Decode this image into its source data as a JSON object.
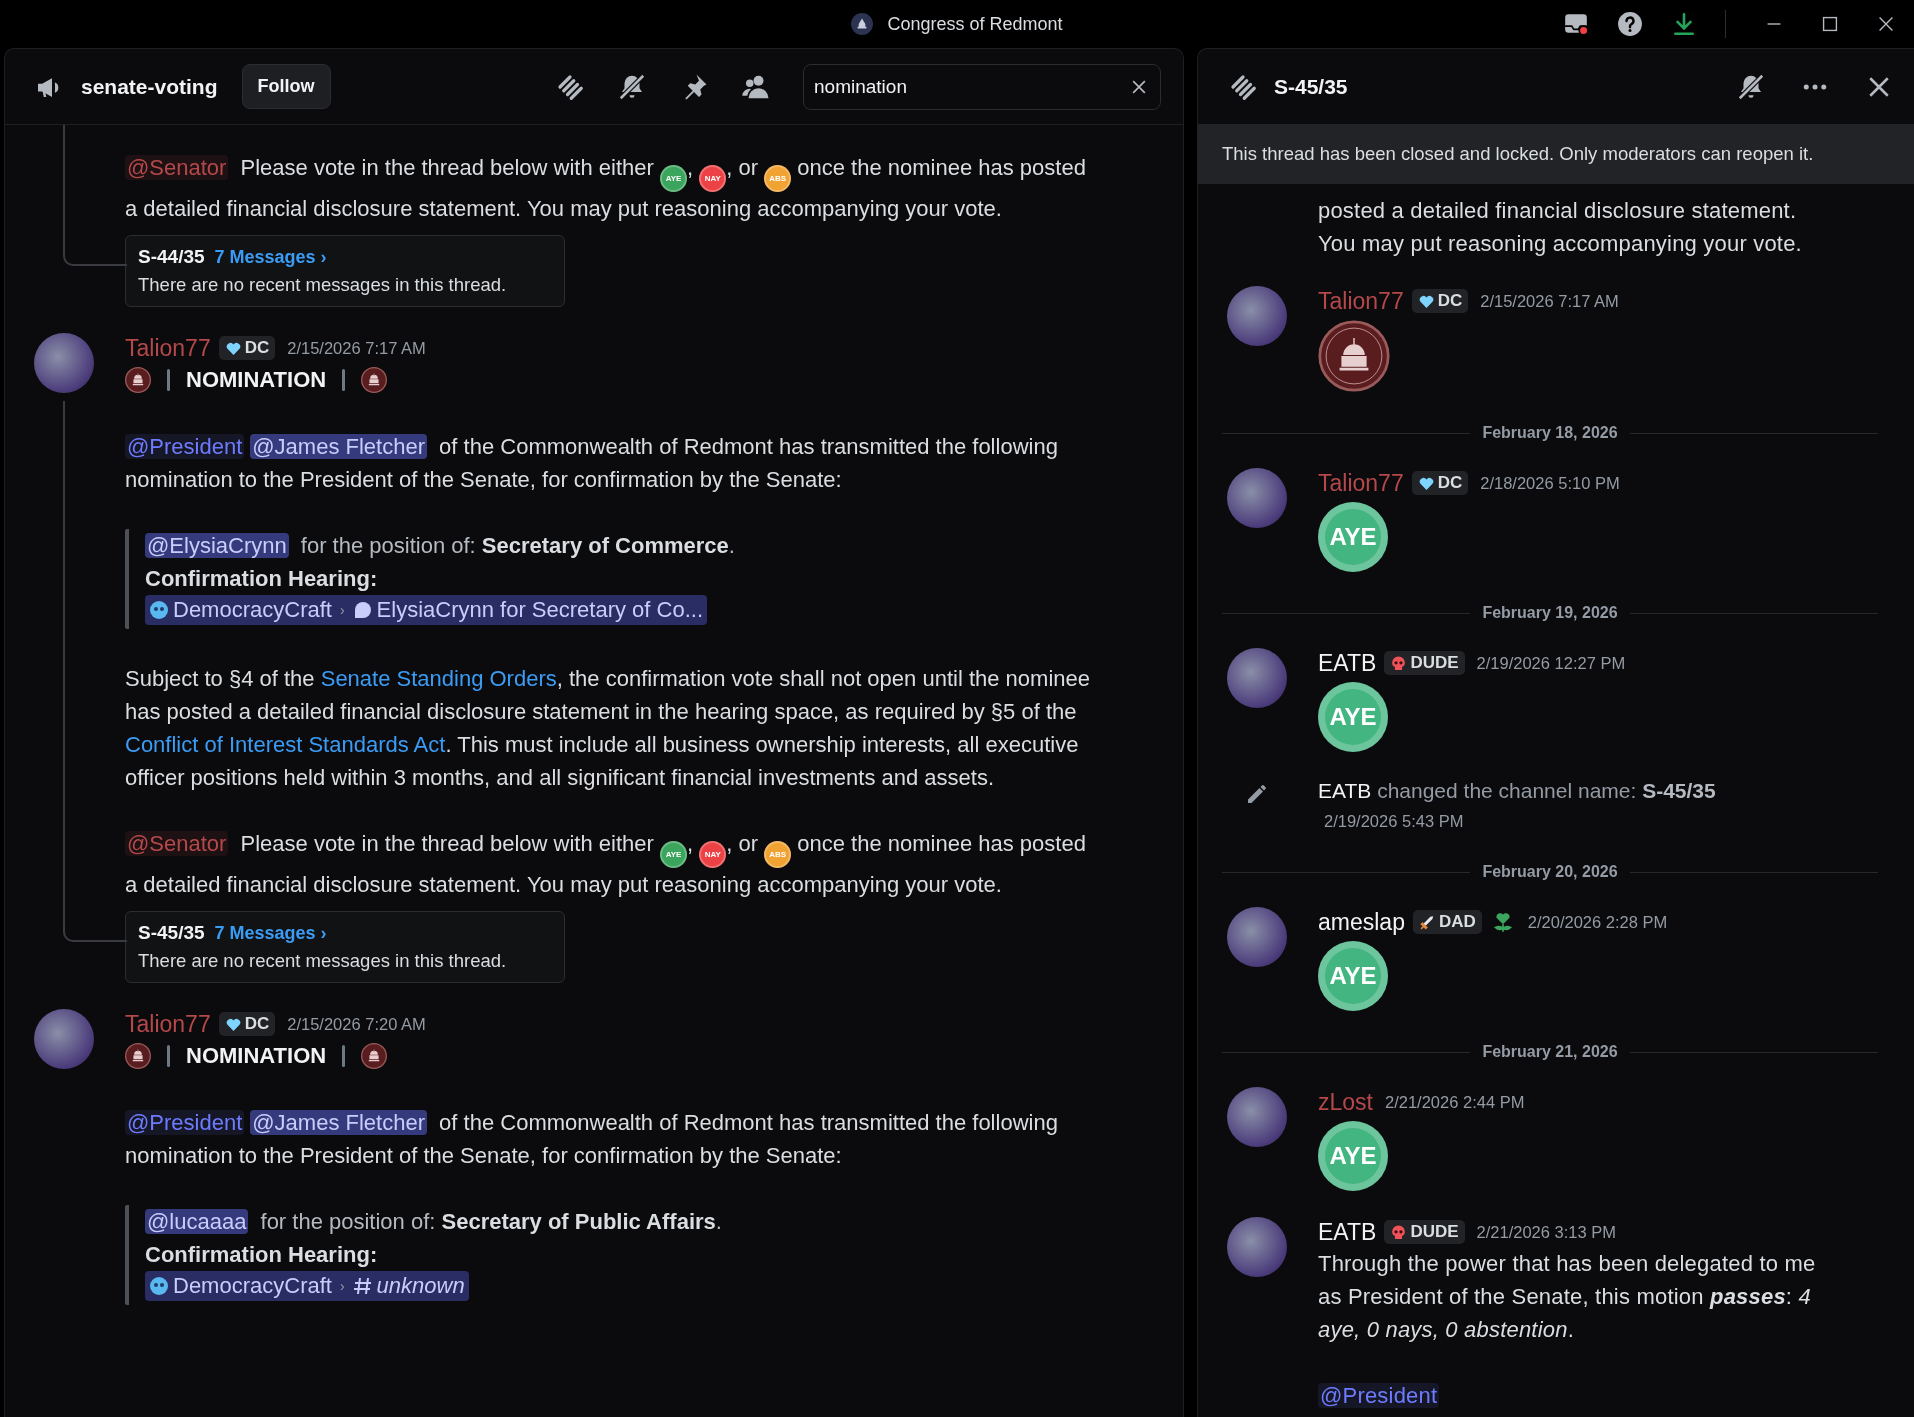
{
  "window": {
    "title": "Congress of Redmont"
  },
  "channel": {
    "name": "senate-voting",
    "follow": "Follow",
    "search": {
      "value": "nomination"
    },
    "items": [
      {
        "kind": "continuation",
        "blocks": [
          {
            "kind": "para",
            "segments": [
              {
                "kind": "role_mention",
                "text": "@Senator",
                "color": "#b5484a"
              },
              {
                "kind": "text",
                "text": " Please vote in the thread below with either "
              },
              {
                "kind": "vote",
                "text": "AYE",
                "color": "#3ba55d"
              },
              {
                "kind": "text",
                "text": ", "
              },
              {
                "kind": "vote",
                "text": "NAY",
                "color": "#ed4245"
              },
              {
                "kind": "text",
                "text": ", or "
              },
              {
                "kind": "vote",
                "text": "ABS",
                "color": "#f0a232"
              },
              {
                "kind": "text",
                "text": "  once the nominee has posted a detailed financial disclosure statement. You may put reasoning accompanying your vote."
              }
            ]
          },
          {
            "kind": "thread",
            "title": "S-44/35",
            "count": "7 Messages ›",
            "preview": "There are no recent messages in this thread."
          }
        ]
      },
      {
        "kind": "message",
        "author": {
          "name": "Talion77",
          "color": "#b5484a"
        },
        "badge": {
          "kind": "heart",
          "text": "DC"
        },
        "time": "2/15/2026 7:17 AM",
        "blocks": [
          {
            "kind": "heading",
            "text": "NOMINATION"
          },
          {
            "kind": "para",
            "segments": [
              {
                "kind": "role_mention",
                "text": "@President",
                "color": "#6e7bff"
              },
              {
                "kind": "user_mention",
                "text": "@James Fletcher"
              },
              {
                "kind": "text",
                "text": "  of the Commonwealth of Redmont has transmitted the following nomination to the President of the Senate, for confirmation by the Senate:"
              }
            ]
          },
          {
            "kind": "quote",
            "lines": [
              [
                {
                  "kind": "user_mention",
                  "text": "@ElysiaCrynn"
                },
                {
                  "kind": "text",
                  "text": " for the position of: "
                },
                {
                  "kind": "bold",
                  "text": "Secretary of Commerce"
                },
                {
                  "kind": "text",
                  "text": "."
                }
              ],
              [
                {
                  "kind": "bold",
                  "text": "Confirmation Hearing:"
                }
              ],
              [
                {
                  "kind": "thread_channel",
                  "server": "DemocracyCraft",
                  "separator": "›",
                  "name": "ElysiaCrynn for Secretary of Co..."
                }
              ]
            ]
          },
          {
            "kind": "para",
            "segments": [
              {
                "kind": "text",
                "text": "Subject to §4 of the "
              },
              {
                "kind": "link",
                "text": "Senate Standing Orders"
              },
              {
                "kind": "text",
                "text": ", the confirmation vote shall not open until the nominee has posted a detailed financial disclosure statement in the hearing space, as required by §5 of the "
              },
              {
                "kind": "link",
                "text": "Conflict of Interest Standards Act"
              },
              {
                "kind": "text",
                "text": ". This must include all business ownership interests, all executive officer positions held within 3 months, and all significant financial investments and assets."
              }
            ]
          },
          {
            "kind": "para",
            "segments": [
              {
                "kind": "role_mention",
                "text": "@Senator",
                "color": "#b5484a"
              },
              {
                "kind": "text",
                "text": " Please vote in the thread below with either "
              },
              {
                "kind": "vote",
                "text": "AYE",
                "color": "#3ba55d"
              },
              {
                "kind": "text",
                "text": ", "
              },
              {
                "kind": "vote",
                "text": "NAY",
                "color": "#ed4245"
              },
              {
                "kind": "text",
                "text": ", or "
              },
              {
                "kind": "vote",
                "text": "ABS",
                "color": "#f0a232"
              },
              {
                "kind": "text",
                "text": "  once the nominee has posted a detailed financial disclosure statement. You may put reasoning accompanying your vote."
              }
            ]
          },
          {
            "kind": "thread",
            "title": "S-45/35",
            "count": "7 Messages ›",
            "preview": "There are no recent messages in this thread."
          }
        ]
      },
      {
        "kind": "message",
        "author": {
          "name": "Talion77",
          "color": "#b5484a"
        },
        "badge": {
          "kind": "heart",
          "text": "DC"
        },
        "time": "2/15/2026 7:20 AM",
        "blocks": [
          {
            "kind": "heading",
            "text": "NOMINATION"
          },
          {
            "kind": "para",
            "segments": [
              {
                "kind": "role_mention",
                "text": "@President",
                "color": "#6e7bff"
              },
              {
                "kind": "user_mention",
                "text": "@James Fletcher"
              },
              {
                "kind": "text",
                "text": "  of the Commonwealth of Redmont has transmitted the following nomination to the President of the Senate, for confirmation by the Senate:"
              }
            ]
          },
          {
            "kind": "quote",
            "lines": [
              [
                {
                  "kind": "user_mention",
                  "text": "@lucaaaa"
                },
                {
                  "kind": "text",
                  "text": " for the position of: "
                },
                {
                  "kind": "bold",
                  "text": "Secretary of Public Affairs"
                },
                {
                  "kind": "text",
                  "text": "."
                }
              ],
              [
                {
                  "kind": "bold",
                  "text": "Confirmation Hearing:"
                }
              ],
              [
                {
                  "kind": "unknown_channel",
                  "server": "DemocracyCraft",
                  "separator": "›",
                  "name": "unknown"
                }
              ]
            ]
          }
        ]
      }
    ]
  },
  "thread": {
    "name": "S-45/35",
    "banner": "This thread has been closed and locked. Only moderators can reopen it.",
    "items": [
      {
        "kind": "continuation",
        "blocks": [
          {
            "kind": "para",
            "segments": [
              {
                "kind": "text",
                "text": "posted a detailed financial disclosure statement.\nYou may put reasoning accompanying your vote."
              }
            ]
          }
        ]
      },
      {
        "kind": "message",
        "author": {
          "name": "Talion77",
          "color": "#b5484a"
        },
        "badge": {
          "kind": "heart",
          "text": "DC"
        },
        "time": "2/15/2026 7:17 AM",
        "blocks": [
          {
            "kind": "sticker"
          }
        ]
      },
      {
        "kind": "divider",
        "text": "February 18, 2026"
      },
      {
        "kind": "message",
        "author": {
          "name": "Talion77",
          "color": "#b5484a"
        },
        "badge": {
          "kind": "heart",
          "text": "DC"
        },
        "time": "2/18/2026 5:10 PM",
        "blocks": [
          {
            "kind": "jumbo",
            "text": "AYE",
            "color": "#43b581"
          }
        ]
      },
      {
        "kind": "divider",
        "text": "February 19, 2026"
      },
      {
        "kind": "message",
        "author": {
          "name": "EATB",
          "color": "#f2f3f5"
        },
        "badge": {
          "kind": "skull",
          "text": "DUDE"
        },
        "time": "2/19/2026 12:27 PM",
        "blocks": [
          {
            "kind": "jumbo",
            "text": "AYE",
            "color": "#43b581"
          }
        ]
      },
      {
        "kind": "system",
        "actor": "EATB",
        "action": " changed the channel name: ",
        "value": "S-45/35",
        "time": "2/19/2026 5:43 PM"
      },
      {
        "kind": "divider",
        "text": "February 20, 2026"
      },
      {
        "kind": "message",
        "author": {
          "name": "ameslap",
          "color": "#f2f3f5",
          "decorated": true
        },
        "badge": {
          "kind": "sword",
          "text": "DAD"
        },
        "time": "2/20/2026 2:28 PM",
        "blocks": [
          {
            "kind": "jumbo",
            "text": "AYE",
            "color": "#43b581"
          }
        ]
      },
      {
        "kind": "divider",
        "text": "February 21, 2026"
      },
      {
        "kind": "message",
        "author": {
          "name": "zLost",
          "color": "#b5484a"
        },
        "time": "2/21/2026 2:44 PM",
        "blocks": [
          {
            "kind": "jumbo",
            "text": "AYE",
            "color": "#43b581"
          }
        ]
      },
      {
        "kind": "message",
        "author": {
          "name": "EATB",
          "color": "#f2f3f5"
        },
        "badge": {
          "kind": "skull",
          "text": "DUDE"
        },
        "time": "2/21/2026 3:13 PM",
        "blocks": [
          {
            "kind": "para",
            "segments": [
              {
                "kind": "text",
                "text": "Through the power that has been delegated to me as President of the Senate, this motion "
              },
              {
                "kind": "bold_italic",
                "text": "passes"
              },
              {
                "kind": "text",
                "text": ": "
              },
              {
                "kind": "italic",
                "text": "4 aye, 0 nays, 0 abstention"
              },
              {
                "kind": "text",
                "text": "."
              }
            ]
          },
          {
            "kind": "para",
            "segments": [
              {
                "kind": "role_mention",
                "text": "@President",
                "color": "#6e7bff"
              }
            ]
          }
        ]
      }
    ]
  }
}
